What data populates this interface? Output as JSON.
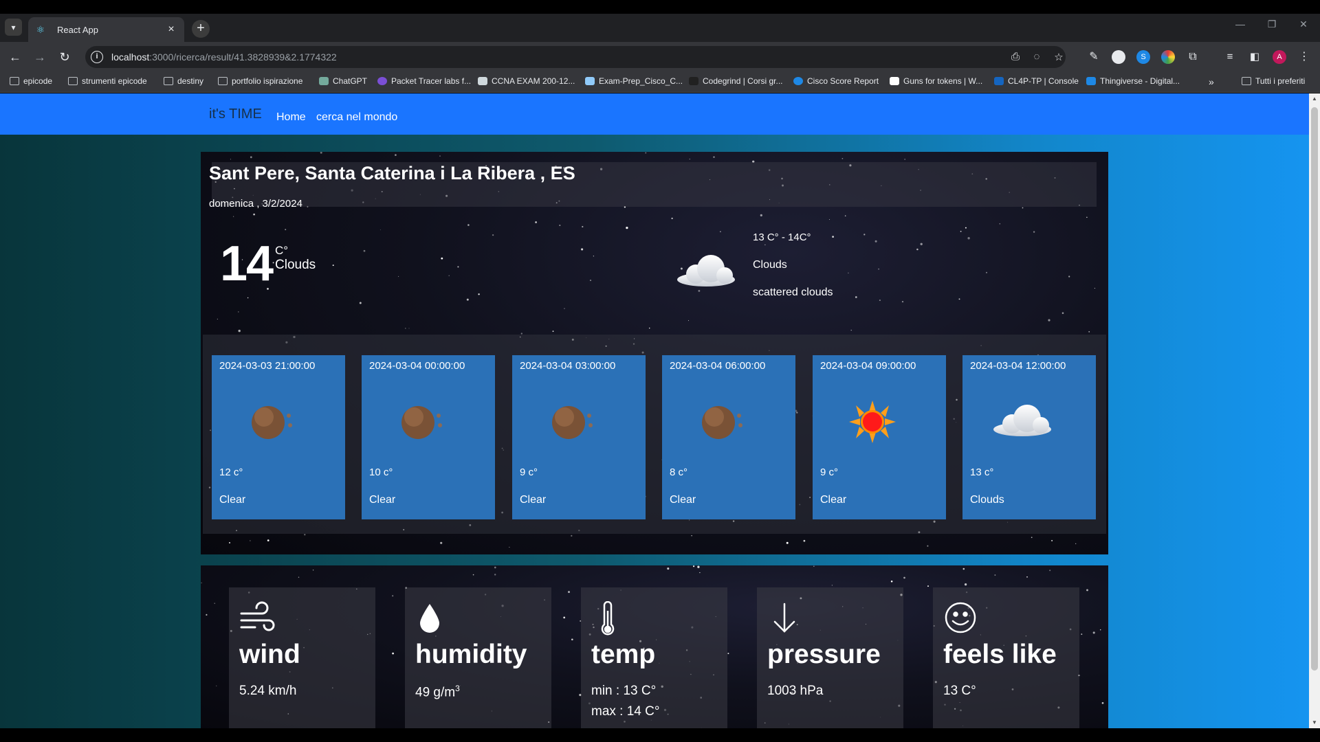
{
  "browser": {
    "tab_title": "React App",
    "url_host": "localhost",
    "url_rest": ":3000/ricerca/result/41.3828939&2.1774322",
    "profile_initial": "A",
    "bookmarks": [
      {
        "label": "epicode",
        "icon": "folder-icon"
      },
      {
        "label": "strumenti epicode",
        "icon": "folder-icon"
      },
      {
        "label": "destiny",
        "icon": "folder-icon"
      },
      {
        "label": "portfolio ispirazione",
        "icon": "folder-icon"
      },
      {
        "label": "ChatGPT",
        "icon": "chatgpt-icon"
      },
      {
        "label": "Packet Tracer labs f...",
        "icon": "packet-tracer-icon"
      },
      {
        "label": "CCNA EXAM 200-12...",
        "icon": "ccna-icon"
      },
      {
        "label": "Exam-Prep_Cisco_C...",
        "icon": "document-icon"
      },
      {
        "label": "Codegrind | Corsi gr...",
        "icon": "codegrind-icon"
      },
      {
        "label": "Cisco Score Report",
        "icon": "cisco-icon"
      },
      {
        "label": "Guns for tokens | W...",
        "icon": "guns-icon"
      },
      {
        "label": "CL4P-TP | Console",
        "icon": "cl4p-icon"
      },
      {
        "label": "Thingiverse - Digital...",
        "icon": "thingiverse-icon"
      }
    ],
    "all_bookmarks_label": "Tutti i preferiti"
  },
  "navbar": {
    "brand": "it's TIME",
    "links": [
      "Home",
      "cerca nel mondo"
    ]
  },
  "current": {
    "location": "Sant Pere, Santa Caterina i La Ribera , ES",
    "date": "domenica , 3/2/2024",
    "temp": "14",
    "unit": "C°",
    "condition": "Clouds",
    "range": "13 C° - 14C°",
    "main": "Clouds",
    "description": "scattered clouds",
    "icon": "cloud-icon"
  },
  "forecast": [
    {
      "time": "2024-03-03 21:00:00",
      "temp": "12 c°",
      "desc": "Clear",
      "icon": "moon-icon"
    },
    {
      "time": "2024-03-04 00:00:00",
      "temp": "10 c°",
      "desc": "Clear",
      "icon": "moon-icon"
    },
    {
      "time": "2024-03-04 03:00:00",
      "temp": "9 c°",
      "desc": "Clear",
      "icon": "moon-icon"
    },
    {
      "time": "2024-03-04 06:00:00",
      "temp": "8 c°",
      "desc": "Clear",
      "icon": "moon-icon"
    },
    {
      "time": "2024-03-04 09:00:00",
      "temp": "9 c°",
      "desc": "Clear",
      "icon": "sun-icon"
    },
    {
      "time": "2024-03-04 12:00:00",
      "temp": "13 c°",
      "desc": "Clouds",
      "icon": "cloud-icon"
    }
  ],
  "stats": {
    "wind": {
      "title": "wind",
      "value": "5.24 km/h",
      "icon": "wind-icon"
    },
    "humidity": {
      "title": "humidity",
      "value": "49 g/m",
      "sup": "3",
      "icon": "drop-icon"
    },
    "temp": {
      "title": "temp",
      "min": "min : 13 C°",
      "max": "max : 14 C°",
      "icon": "thermometer-icon"
    },
    "pressure": {
      "title": "pressure",
      "value": "1003 hPa",
      "icon": "arrow-down-icon"
    },
    "feels_like": {
      "title": "feels like",
      "value": "13 C°",
      "icon": "smiley-icon"
    }
  },
  "colors": {
    "navbar": "#1a75ff",
    "card": "#2b71b7",
    "brand_text": "#16304a"
  }
}
